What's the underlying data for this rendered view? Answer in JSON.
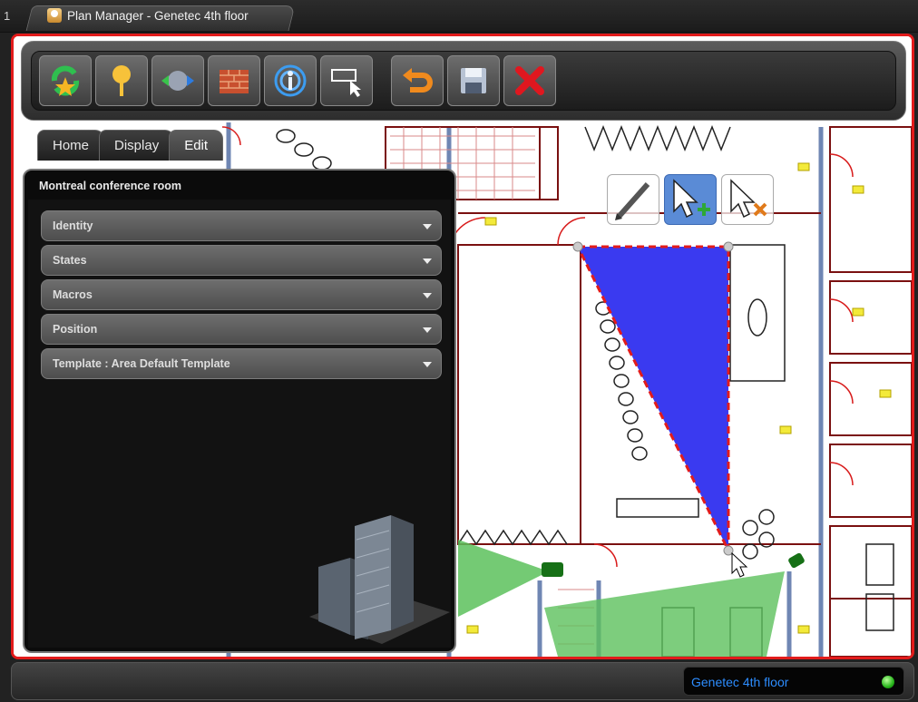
{
  "window": {
    "tab_number": "1",
    "title": "Plan Manager - Genetec 4th floor"
  },
  "toolbar": {
    "buttons": [
      {
        "name": "refresh-map-icon"
      },
      {
        "name": "pin-icon"
      },
      {
        "name": "link-icon"
      },
      {
        "name": "brick-wall-icon"
      },
      {
        "name": "signal-icon"
      },
      {
        "name": "select-area-icon"
      },
      {
        "name": "undo-icon"
      },
      {
        "name": "save-icon"
      },
      {
        "name": "close-icon"
      }
    ]
  },
  "side_tabs": [
    "Home",
    "Display",
    "Edit"
  ],
  "active_tab": "Edit",
  "panel": {
    "title": "Montreal conference room",
    "sections": [
      "Identity",
      "States",
      "Macros",
      "Position",
      "Template : Area Default Template"
    ]
  },
  "map_tools": [
    "edit-pencil-icon",
    "add-point-icon",
    "remove-point-icon"
  ],
  "status": {
    "location": "Genetec 4th floor"
  },
  "colors": {
    "frame": "#e21b1b",
    "area_fill": "#3a3af0",
    "camera_fov": "#5cc15c",
    "location_text": "#2d8dff"
  }
}
